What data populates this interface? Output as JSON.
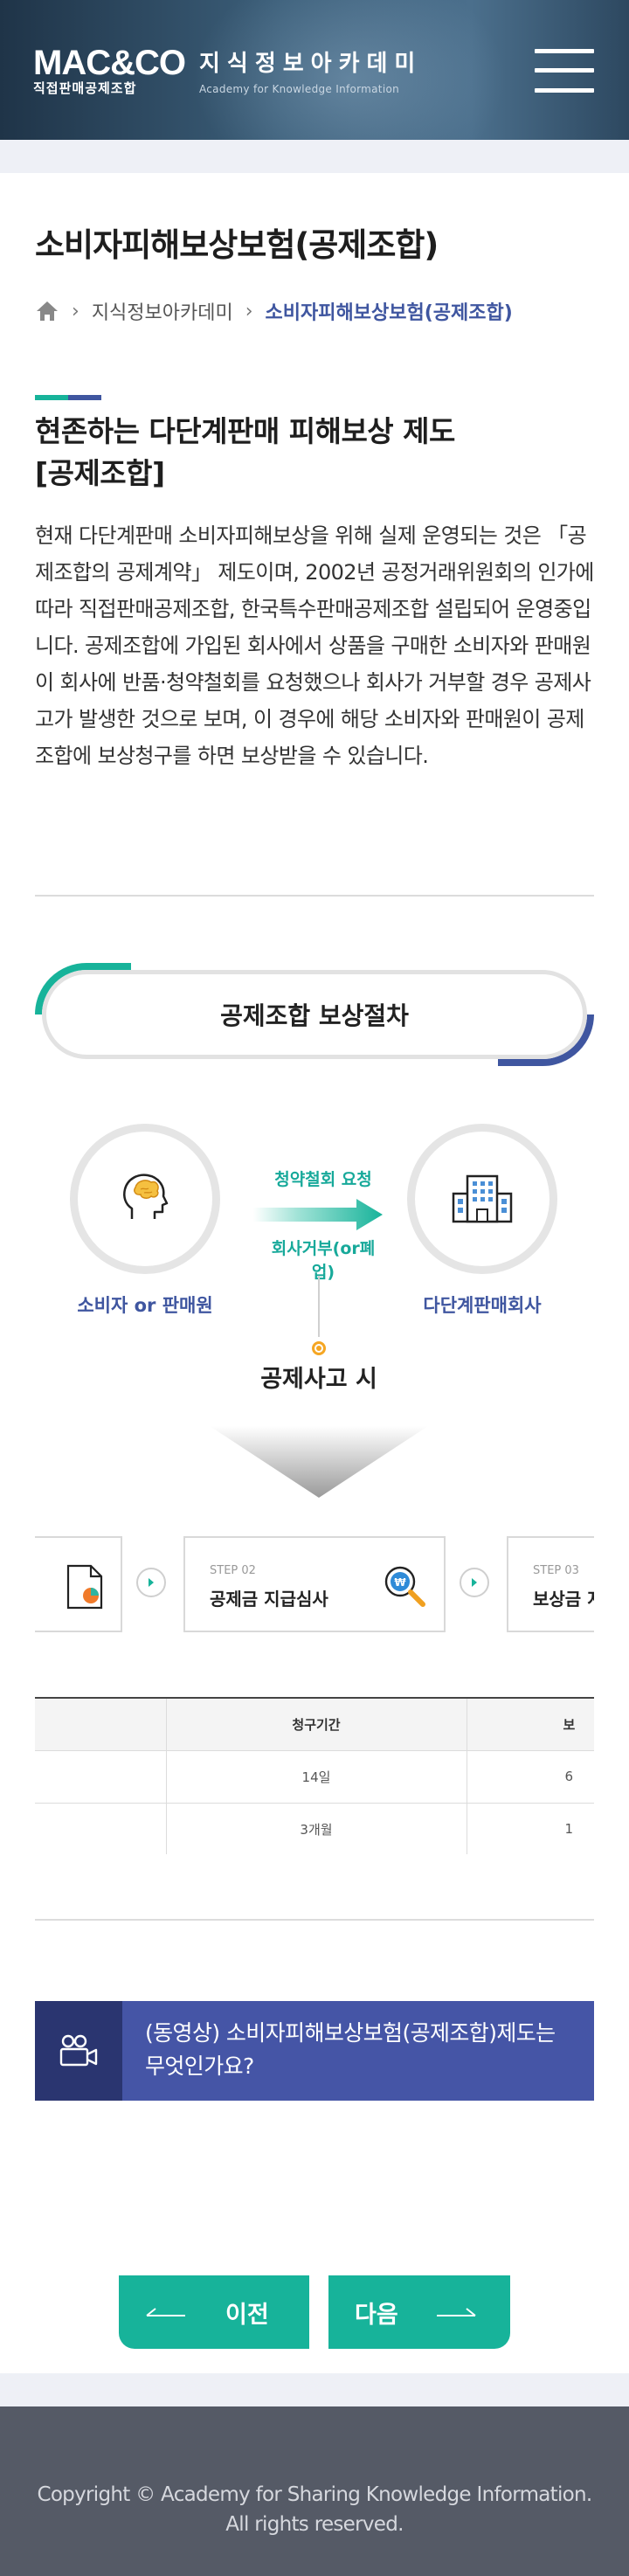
{
  "header": {
    "logo_main": "MAC&CO",
    "logo_sub": "직접판매공제조합",
    "site_name": "지식정보아카데미",
    "site_name_en": "Academy for Knowledge Information",
    "menu_icon": "hamburger-menu-icon"
  },
  "page": {
    "title": "소비자피해보상보험(공제조합)",
    "breadcrumb": {
      "home_icon": "home-icon",
      "item1": "지식정보아카데미",
      "current": "소비자피해보상보험(공제조합)"
    }
  },
  "section": {
    "heading_line1": "현존하는 다단계판매 피해보상 제도",
    "heading_line2": "[공제조합]",
    "body": "현재 다단계판매 소비자피해보상을 위해 실제 운영되는 것은 「공제조합의 공제계약」 제도이며, 2002년 공정거래위원회의 인가에 따라 직접판매공제조합, 한국특수판매공제조합 설립되어 운영중입니다. 공제조합에 가입된 회사에서 상품을 구매한 소비자와 판매원이 회사에 반품·청약철회를 요청했으나 회사가 거부할 경우 공제사고가 발생한 것으로 보며, 이 경우에 해당 소비자와 판매원이 공제조합에 보상청구를 하면 보상받을 수 있습니다."
  },
  "procedure": {
    "title": "공제조합 보상절차",
    "consumer_label": "소비자 or 판매원",
    "company_label": "다단계판매회사",
    "arrow_top": "청약철회 요청",
    "arrow_bottom": "회사거부(or폐업)",
    "accident": "공제사고 시",
    "steps": [
      {
        "num": "STEP 02",
        "title": "공제금 지급심사"
      },
      {
        "num": "STEP 03",
        "title": "보상금 지급"
      }
    ]
  },
  "table": {
    "headers": [
      "",
      "청구기간",
      "보"
    ],
    "rows": [
      [
        "",
        "14일",
        "6"
      ],
      [
        "",
        "3개월",
        "1"
      ]
    ]
  },
  "video": {
    "icon": "video-camera-icon",
    "text": "(동영상) 소비자피해보상보험(공제조합)제도는 무엇인가요?"
  },
  "nav": {
    "prev_label": "이전",
    "next_label": "다음"
  },
  "footer": {
    "copyright": "Copyright © Academy for Sharing Knowledge Information. All rights reserved."
  },
  "colors": {
    "accent_blue": "#3f56a0",
    "accent_teal": "#17b39a",
    "dark_navy": "#2a3570"
  }
}
